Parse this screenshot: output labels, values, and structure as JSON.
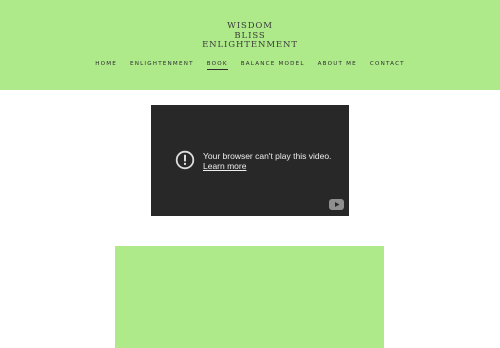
{
  "site": {
    "logo_lines": [
      "WISDOM",
      "BLISS",
      "ENLIGHTENMENT"
    ]
  },
  "nav": {
    "items": [
      {
        "label": "HOME",
        "active": false
      },
      {
        "label": "ENLIGHTENMENT",
        "active": false
      },
      {
        "label": "BOOK",
        "active": true
      },
      {
        "label": "BALANCE MODEL",
        "active": false
      },
      {
        "label": "ABOUT ME",
        "active": false
      },
      {
        "label": "CONTACT",
        "active": false
      }
    ]
  },
  "video": {
    "message": "Your browser can't play this video.",
    "link_label": "Learn more",
    "icon": "alert-circle-icon",
    "brand_icon": "youtube-icon"
  },
  "colors": {
    "accent": "#aee98a",
    "video_bg": "#282828",
    "text": "#2f2f2f"
  }
}
